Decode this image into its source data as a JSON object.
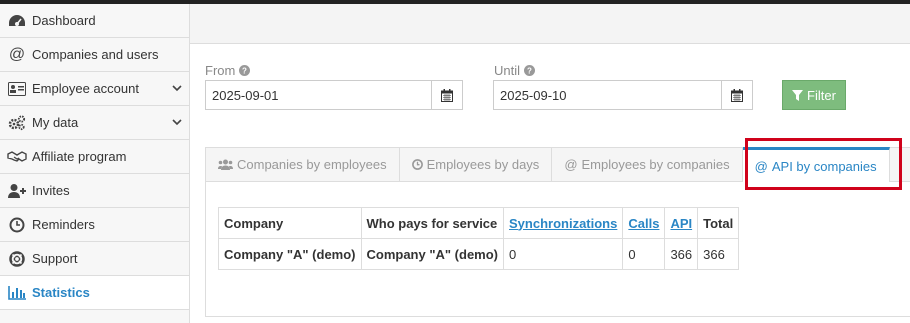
{
  "sidebar": {
    "items": [
      {
        "label": "Dashboard",
        "icon": "dashboard-icon"
      },
      {
        "label": "Companies and users",
        "icon": "at-icon"
      },
      {
        "label": "Employee account",
        "icon": "id-card-icon",
        "expandable": true
      },
      {
        "label": "My data",
        "icon": "gears-icon",
        "expandable": true
      },
      {
        "label": "Affiliate program",
        "icon": "handshake-icon"
      },
      {
        "label": "Invites",
        "icon": "user-plus-icon"
      },
      {
        "label": "Reminders",
        "icon": "clock-icon"
      },
      {
        "label": "Support",
        "icon": "life-ring-icon"
      },
      {
        "label": "Statistics",
        "icon": "bar-chart-icon",
        "active": true
      }
    ]
  },
  "filters": {
    "from_label": "From",
    "from_value": "2025-09-01",
    "until_label": "Until",
    "until_value": "2025-09-10",
    "filter_button": "Filter"
  },
  "tabs": [
    {
      "label": "Companies by employees",
      "icon": "users-icon"
    },
    {
      "label": "Employees by days",
      "icon": "clock-icon"
    },
    {
      "label": "Employees by companies",
      "icon": "at-icon"
    },
    {
      "label": "API by companies",
      "icon": "at-icon",
      "active": true
    }
  ],
  "table": {
    "headers": [
      "Company",
      "Who pays for service",
      "Synchronizations",
      "Calls",
      "API",
      "Total"
    ],
    "rows": [
      [
        "Company \"A\" (demo)",
        "Company \"A\" (demo)",
        "0",
        "0",
        "366",
        "366"
      ]
    ]
  },
  "colors": {
    "accent": "#2a86c5",
    "filter_button": "#7ebc7e",
    "highlight_box": "#d0021b"
  }
}
